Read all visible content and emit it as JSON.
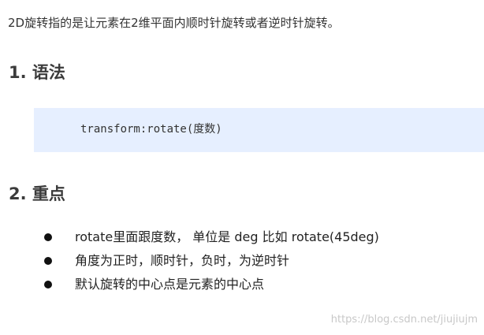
{
  "intro": "2D旋转指的是让元素在2维平面内顺时针旋转或者逆时针旋转。",
  "sections": [
    {
      "heading": "1. 语法"
    },
    {
      "heading": "2. 重点"
    }
  ],
  "code": "transform:rotate(度数)",
  "bullets": [
    "rotate里面跟度数， 单位是 deg  比如  rotate(45deg)",
    "角度为正时，顺时针，负时，为逆时针",
    "默认旋转的中心点是元素的中心点"
  ],
  "watermark": "https://blog.csdn.net/jiujiujm"
}
